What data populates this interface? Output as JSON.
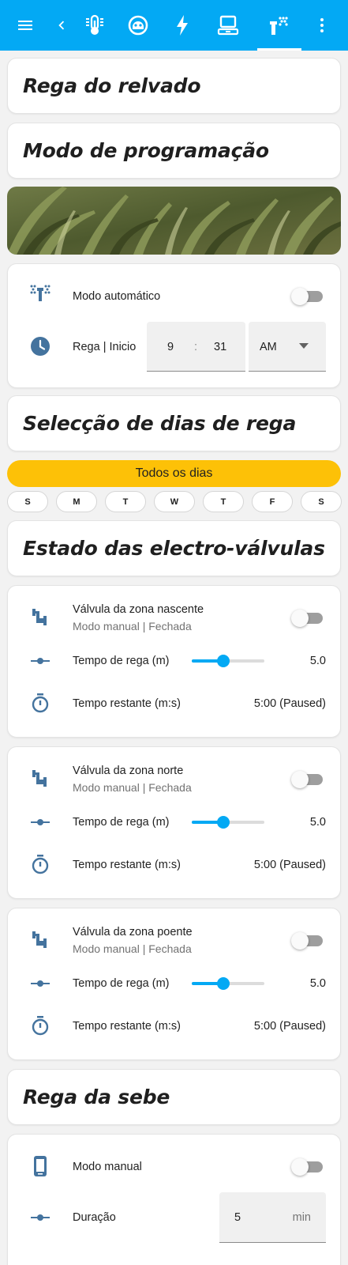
{
  "colors": {
    "primary": "#03a9f4",
    "icon": "#44739e",
    "banner": "#fdc107",
    "toggle_off": "#9e9e9e"
  },
  "toolbar": {
    "icons": [
      "menu-icon",
      "back-icon",
      "thermometer-icon",
      "robot-vacuum-icon",
      "lightning-icon",
      "laptop-icon",
      "sprinkler-icon",
      "more-vert-icon"
    ],
    "active_tab": "sprinkler-icon"
  },
  "lawn": {
    "title": "Rega do relvado",
    "mode_title": "Modo de programação",
    "auto_mode_label": "Modo automático",
    "auto_mode_on": false,
    "start_label": "Rega | Inicio",
    "start_hour": "9",
    "time_sep": ":",
    "start_minute": "31",
    "start_ampm": "AM"
  },
  "days": {
    "title": "Selecção de dias de rega",
    "all_days_label": "Todos os dias",
    "chips": [
      "S",
      "M",
      "T",
      "W",
      "T",
      "F",
      "S"
    ]
  },
  "valves": {
    "title": "Estado das electro-válvulas",
    "items": [
      {
        "name": "Válvula da zona nascente",
        "status": "Modo manual | Fechada",
        "on": false,
        "duration_label": "Tempo de rega (m)",
        "duration_value": "5.0",
        "duration_fraction": 0.44,
        "remaining_label": "Tempo restante (m:s)",
        "remaining_value": "5:00 (Paused)"
      },
      {
        "name": "Válvula da zona norte",
        "status": "Modo manual | Fechada",
        "on": false,
        "duration_label": "Tempo de rega (m)",
        "duration_value": "5.0",
        "duration_fraction": 0.44,
        "remaining_label": "Tempo restante (m:s)",
        "remaining_value": "5:00 (Paused)"
      },
      {
        "name": "Válvula da zona poente",
        "status": "Modo manual | Fechada",
        "on": false,
        "duration_label": "Tempo de rega (m)",
        "duration_value": "5.0",
        "duration_fraction": 0.44,
        "remaining_label": "Tempo restante (m:s)",
        "remaining_value": "5:00 (Paused)"
      }
    ]
  },
  "hedge": {
    "title": "Rega da sebe",
    "manual_label": "Modo manual",
    "manual_on": false,
    "duration_label": "Duração",
    "duration_value": "5",
    "duration_unit": "min"
  }
}
